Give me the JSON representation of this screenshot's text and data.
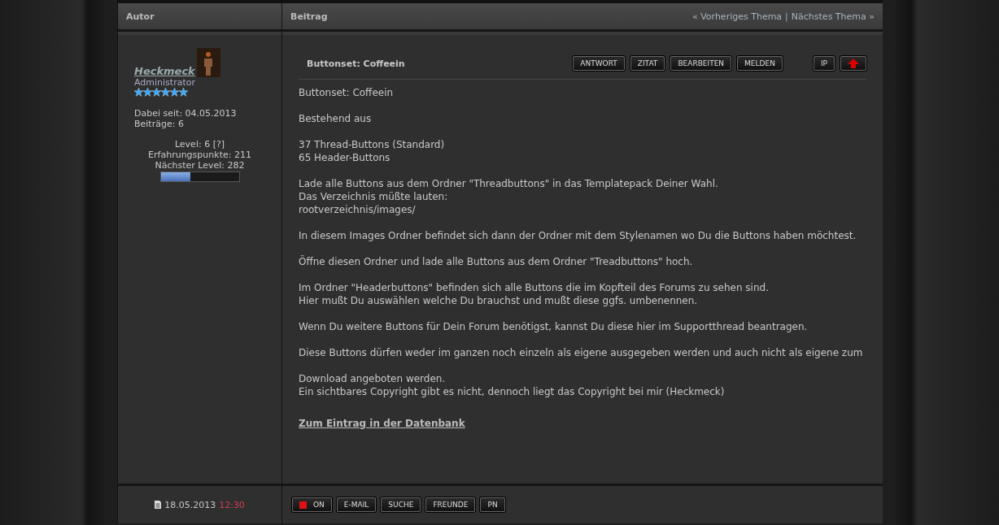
{
  "header": {
    "author_column": "Autor",
    "post_column": "Beitrag",
    "prev_link": "« Vorheriges Thema",
    "separator": "|",
    "next_link": "Nächstes Thema »"
  },
  "author": {
    "name": "Heckmeck",
    "rank": "Administrator",
    "stars": 6,
    "joined": "Dabei seit: 04.05.2013",
    "posts": "Beiträge: 6",
    "level_label": "Level: 6",
    "level_help": "[?]",
    "experience": "Erfahrungspunkte: 211",
    "next_level": "Nächster Level: 282",
    "level": 0.38
  },
  "post": {
    "title": "Buttonset: Coffeein",
    "actions": [
      "ANTWORT",
      "ZITAT",
      "BEARBEITEN",
      "MELDEN"
    ],
    "ip_button": "IP",
    "paragraphs": [
      [
        "Buttonset: Coffeein"
      ],
      [
        "Bestehend aus"
      ],
      [
        "37 Thread-Buttons (Standard)",
        "65 Header-Buttons"
      ],
      [
        "Lade alle Buttons aus dem Ordner \"Threadbuttons\" in das Templatepack Deiner Wahl.",
        "Das Verzeichnis müßte lauten:",
        "rootverzeichnis/images/"
      ],
      [
        "In diesem Images Ordner befindet sich dann der Ordner mit dem Stylenamen wo Du die Buttons haben möchtest."
      ],
      [
        "Öffne diesen Ordner und lade alle Buttons aus dem Ordner \"Treadbuttons\" hoch."
      ],
      [
        "Im Ordner \"Headerbuttons\" befinden sich alle Buttons die im Kopfteil des Forums zu sehen sind.",
        "Hier mußt Du auswählen welche Du brauchst und mußt diese ggfs. umbenennen."
      ],
      [
        "Wenn Du weitere Buttons für Dein Forum benötigst, kannst Du diese hier im Supportthread beantragen."
      ],
      [
        "Diese Buttons dürfen weder im ganzen noch einzeln als eigene ausgegeben werden und auch nicht als eigene zum"
      ],
      [
        "Download angeboten werden.",
        "Ein sichtbares Copyright gibt es nicht, dennoch liegt das Copyright bei mir (Heckmeck)"
      ]
    ],
    "link": "Zum Eintrag in der Datenbank"
  },
  "footer": {
    "date": "18.05.2013",
    "time": "12:30",
    "online": true,
    "online_label": "ON",
    "buttons": [
      "E-MAIL",
      "SUCHE",
      "FREUNDE",
      "PN"
    ]
  }
}
